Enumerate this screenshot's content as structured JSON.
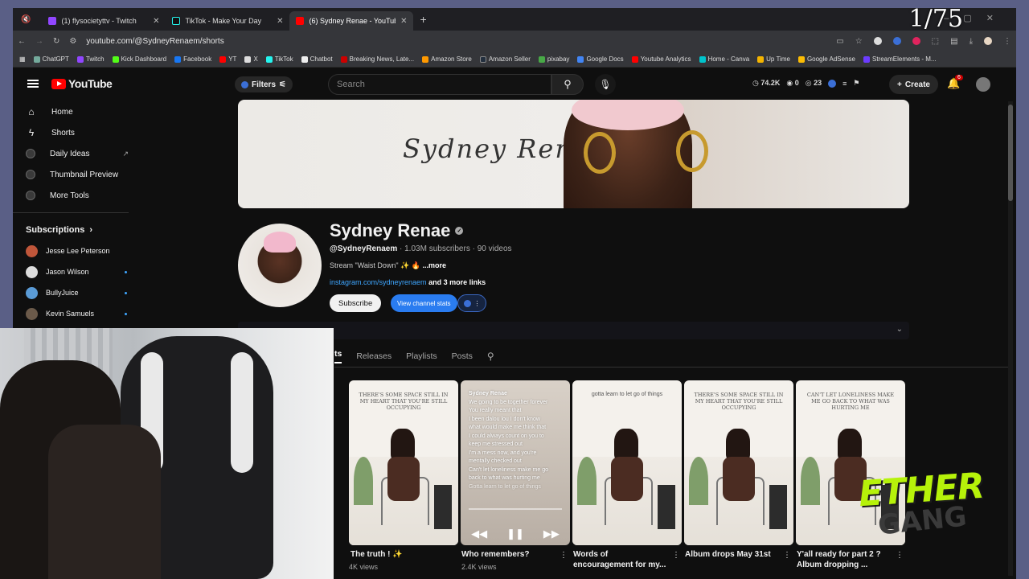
{
  "overlay": {
    "counter": "1/75",
    "brand_top": "ETHER",
    "brand_bottom": "GANG"
  },
  "browser": {
    "tabs": [
      {
        "title": "(1) flysocietyttv - Twitch",
        "color": "#9146ff"
      },
      {
        "title": "TikTok - Make Your Day",
        "color": "#000000"
      },
      {
        "title": "(6) Sydney Renae - YouTube",
        "color": "#ff0000"
      }
    ],
    "url": "youtube.com/@SydneyRenaem/shorts",
    "bookmarks": [
      {
        "label": "ChatGPT",
        "color": "#74aa9c"
      },
      {
        "label": "Twitch",
        "color": "#9146ff"
      },
      {
        "label": "Kick Dashboard",
        "color": "#53fc18"
      },
      {
        "label": "Facebook",
        "color": "#1877f2"
      },
      {
        "label": "YT",
        "color": "#ff0000"
      },
      {
        "label": "X",
        "color": "#dddddd"
      },
      {
        "label": "TikTok",
        "color": "#25f4ee"
      },
      {
        "label": "Chatbot",
        "color": "#eeeeee"
      },
      {
        "label": "Breaking News, Late...",
        "color": "#cc0000"
      },
      {
        "label": "Amazon Store",
        "color": "#ff9900"
      },
      {
        "label": "Amazon Seller",
        "color": "#232f3e"
      },
      {
        "label": "pixabay",
        "color": "#48a947"
      },
      {
        "label": "Google Docs",
        "color": "#4285f4"
      },
      {
        "label": "Youtube Analytics",
        "color": "#ff0000"
      },
      {
        "label": "Home - Canva",
        "color": "#00c4cc"
      },
      {
        "label": "Up Time",
        "color": "#f4b400"
      },
      {
        "label": "Google AdSense",
        "color": "#fbbc04"
      },
      {
        "label": "StreamElements - M...",
        "color": "#6c3cff"
      }
    ]
  },
  "youtube": {
    "logo_text": "YouTube",
    "filters_label": "Filters",
    "search_placeholder": "Search",
    "stats": {
      "views": "74.2K",
      "likes": "0",
      "comments": "23"
    },
    "create_label": "Create",
    "notif_count": "6"
  },
  "sidebar": {
    "items": [
      {
        "label": "Home",
        "icon": "home-icon"
      },
      {
        "label": "Shorts",
        "icon": "shorts-icon"
      },
      {
        "label": "Daily Ideas",
        "icon": "extension-icon"
      },
      {
        "label": "Thumbnail Preview",
        "icon": "extension-icon"
      },
      {
        "label": "More Tools",
        "icon": "extension-icon"
      }
    ],
    "subscriptions_label": "Subscriptions",
    "subscriptions": [
      {
        "name": "Jesse Lee Peterson",
        "color": "#c0563a",
        "new": false
      },
      {
        "name": "Jason Wilson",
        "color": "#dddddd",
        "new": true
      },
      {
        "name": "BullyJuice",
        "color": "#5a9bd6",
        "new": true
      },
      {
        "name": "Kevin Samuels",
        "color": "#6b5a4a",
        "new": true
      }
    ]
  },
  "channel": {
    "banner_signature": "Sydney Renae",
    "name": "Sydney Renae",
    "handle": "@SydneyRenaem",
    "meta": " · 1.03M subscribers · 90 videos",
    "description": "Stream \"Waist Down\" ✨ 🔥",
    "more": "...more",
    "link": "instagram.com/sydneyrenaem",
    "more_links": "and 3 more links",
    "subscribe_label": "Subscribe",
    "stats_label": "View channel stats",
    "tabs": [
      "ts",
      "Releases",
      "Playlists",
      "Posts"
    ]
  },
  "shorts": [
    {
      "caption": "There's some space still in my heart that you're still occupying",
      "title": "The truth ! ✨",
      "views": "4K views"
    },
    {
      "caption": "",
      "title": "Who remembers?",
      "views": "2.4K views",
      "lyrics_author": "Sydney Renae",
      "lyrics": [
        "We going to be together forever",
        "You really meant that",
        "I been dalou lou I don't know",
        "what would make me think that",
        "I could always count on you to",
        "keep me stressed out",
        "I'm a mess now, and you're",
        "mentally checked out",
        "Can't let loneliness make me go",
        "back to what was hurting me",
        "Gotta learn to let go of things"
      ]
    },
    {
      "caption": "gotta learn to let go of things",
      "title": "Words of encouragement for my...",
      "views": ""
    },
    {
      "caption": "There's some space still in my heart that you're still occupying",
      "title": "Album drops May 31st",
      "views": ""
    },
    {
      "caption": "Can't let loneliness make me go back to what was hurting me",
      "title": "Y'all ready for part 2 ? Album dropping ...",
      "views": ""
    }
  ]
}
